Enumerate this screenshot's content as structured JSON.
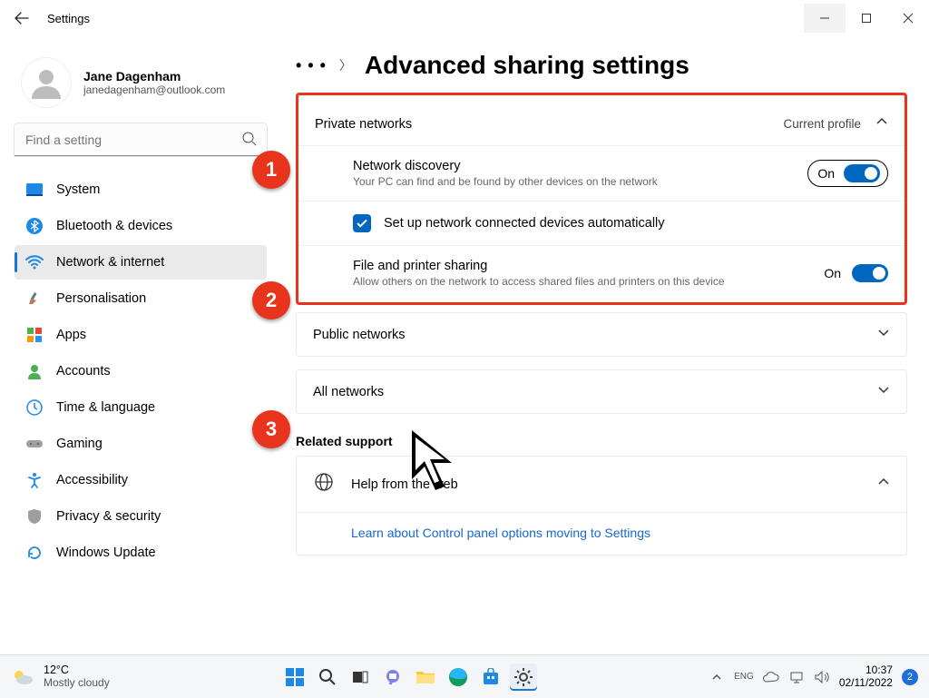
{
  "window": {
    "title": "Settings"
  },
  "user": {
    "name": "Jane Dagenham",
    "email": "janedagenham@outlook.com"
  },
  "search": {
    "placeholder": "Find a setting"
  },
  "nav": {
    "items": [
      {
        "label": "System"
      },
      {
        "label": "Bluetooth & devices"
      },
      {
        "label": "Network & internet"
      },
      {
        "label": "Personalisation"
      },
      {
        "label": "Apps"
      },
      {
        "label": "Accounts"
      },
      {
        "label": "Time & language"
      },
      {
        "label": "Gaming"
      },
      {
        "label": "Accessibility"
      },
      {
        "label": "Privacy & security"
      },
      {
        "label": "Windows Update"
      }
    ]
  },
  "breadcrumb": {
    "title": "Advanced sharing settings"
  },
  "sections": {
    "private": {
      "title": "Private networks",
      "profile_tag": "Current profile",
      "network_discovery": {
        "title": "Network discovery",
        "desc": "Your PC can find and be found by other devices on the network",
        "state_label": "On"
      },
      "auto_setup": {
        "label": "Set up network connected devices automatically"
      },
      "file_printer": {
        "title": "File and printer sharing",
        "desc": "Allow others on the network to access shared files and printers on this device",
        "state_label": "On"
      }
    },
    "public": {
      "title": "Public networks"
    },
    "all": {
      "title": "All networks"
    }
  },
  "related": {
    "heading": "Related support",
    "help_title": "Help from the web",
    "link": "Learn about Control panel options moving to Settings"
  },
  "annotations": {
    "a1": "1",
    "a2": "2",
    "a3": "3"
  },
  "taskbar": {
    "weather": {
      "temp": "12°C",
      "desc": "Mostly cloudy"
    },
    "time": "10:37",
    "date": "02/11/2022",
    "notif_count": "2"
  }
}
